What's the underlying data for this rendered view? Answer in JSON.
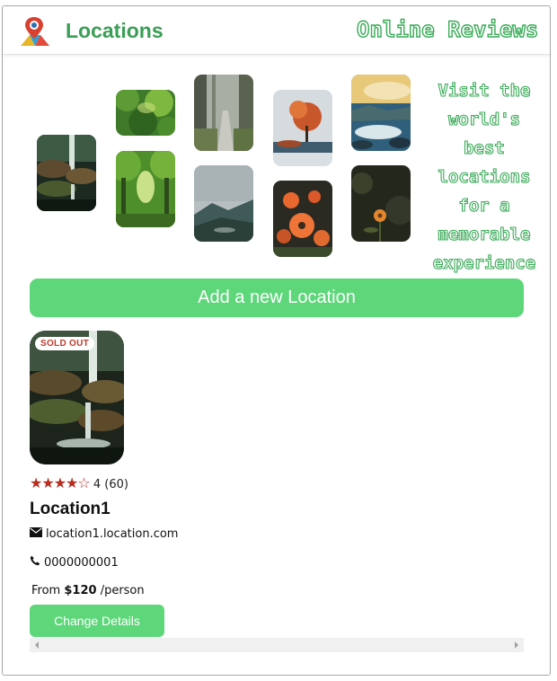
{
  "header": {
    "logo_icon": "map-pin-icon",
    "brand": "Locations",
    "reviews_title": "Online Reviews"
  },
  "gallery": {
    "photos": [
      {
        "name": "waterfall-photo"
      },
      {
        "name": "green-forest-photo"
      },
      {
        "name": "forest-tunnel-photo"
      },
      {
        "name": "misty-path-photo"
      },
      {
        "name": "mountain-valley-photo"
      },
      {
        "name": "autumn-lake-photo"
      },
      {
        "name": "orange-flowers-photo"
      },
      {
        "name": "coast-sunset-photo"
      },
      {
        "name": "dark-flower-photo"
      }
    ],
    "tagline": [
      "Visit the",
      "world's best",
      "locations",
      "for a",
      "memorable",
      "experience"
    ]
  },
  "actions": {
    "add_location": "Add a new Location"
  },
  "location_card": {
    "badge": "SOLD OUT",
    "stars_filled": "★★★★",
    "stars_empty": "☆",
    "rating": "4",
    "reviews": "(60)",
    "title": "Location1",
    "email_icon": "envelope-icon",
    "website": "location1.location.com",
    "phone_icon": "phone-icon",
    "phone": "0000000001",
    "price_prefix": "From",
    "price": "$120",
    "price_suffix": "/person",
    "change_button": "Change Details"
  },
  "colors": {
    "accent_green": "#5ed67a",
    "brand_green": "#3a9e56",
    "star_red": "#b52d1f"
  }
}
